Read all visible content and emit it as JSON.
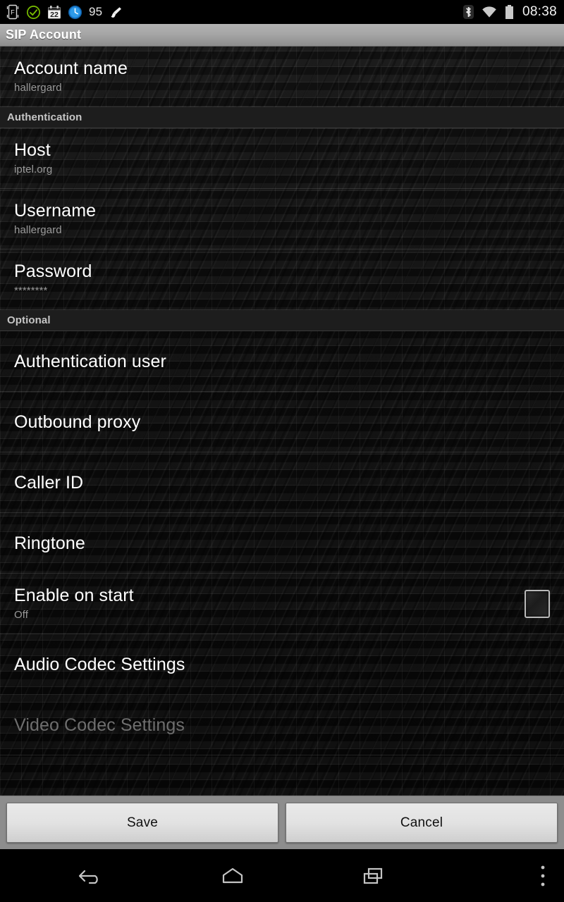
{
  "statusbar": {
    "icons": [
      {
        "name": "fdroid-icon",
        "label": "F"
      },
      {
        "name": "check-circle-icon",
        "label": ""
      },
      {
        "name": "calendar-icon",
        "label": "22"
      },
      {
        "name": "clock-icon",
        "label": ""
      }
    ],
    "battery_text": "95",
    "brush_icon": "brush-icon",
    "bluetooth_icon": "bluetooth-icon",
    "wifi_icon": "wifi-icon",
    "battery_icon": "battery-icon",
    "clock": "08:38"
  },
  "titlebar": {
    "title": "SIP Account"
  },
  "sections": [
    {
      "header": null,
      "rows": [
        {
          "title": "Account name",
          "subtitle": "hallergard",
          "type": "entry",
          "disabled": false,
          "checkbox": false
        }
      ]
    },
    {
      "header": "Authentication",
      "rows": [
        {
          "title": "Host",
          "subtitle": "iptel.org",
          "type": "entry",
          "disabled": false,
          "checkbox": false
        },
        {
          "title": "Username",
          "subtitle": "hallergard",
          "type": "entry",
          "disabled": false,
          "checkbox": false
        },
        {
          "title": "Password",
          "subtitle": "********",
          "type": "entry",
          "disabled": false,
          "checkbox": false
        }
      ]
    },
    {
      "header": "Optional",
      "rows": [
        {
          "title": "Authentication user",
          "subtitle": "",
          "type": "entry",
          "disabled": false,
          "checkbox": false
        },
        {
          "title": "Outbound proxy",
          "subtitle": "",
          "type": "entry",
          "disabled": false,
          "checkbox": false
        },
        {
          "title": "Caller ID",
          "subtitle": "",
          "type": "entry",
          "disabled": false,
          "checkbox": false
        },
        {
          "title": "Ringtone",
          "subtitle": "",
          "type": "entry",
          "disabled": false,
          "checkbox": false
        },
        {
          "title": "Enable on start",
          "subtitle": "Off",
          "type": "checkbox",
          "disabled": false,
          "checkbox": true,
          "checked": false
        },
        {
          "title": "Audio Codec Settings",
          "subtitle": "",
          "type": "entry",
          "disabled": false,
          "checkbox": false
        },
        {
          "title": "Video Codec Settings",
          "subtitle": "",
          "type": "entry",
          "disabled": true,
          "checkbox": false
        }
      ]
    }
  ],
  "buttons": {
    "save_label": "Save",
    "cancel_label": "Cancel"
  },
  "navbar": {
    "back": "back-icon",
    "home": "home-icon",
    "recents": "recents-icon",
    "overflow": "overflow-menu-icon"
  },
  "colors": {
    "title_bar": "#a6a6a6",
    "section_header_bg": "#1d1d1d",
    "section_header_text": "#c6c6c6",
    "row_title": "#ffffff",
    "row_subtitle": "#9a9a9a",
    "disabled_text": "#6e6e6e",
    "button_bar": "#8d8d8d",
    "button_face": "#e2e2e2"
  }
}
